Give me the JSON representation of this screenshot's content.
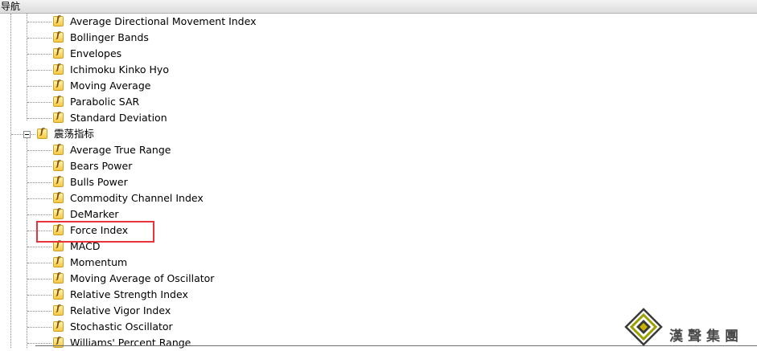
{
  "panel": {
    "title": "导航"
  },
  "tree": {
    "trend_items": [
      "Average Directional Movement Index",
      "Bollinger Bands",
      "Envelopes",
      "Ichimoku Kinko Hyo",
      "Moving Average",
      "Parabolic SAR",
      "Standard Deviation"
    ],
    "oscillators_folder": "震荡指标",
    "oscillator_items": [
      "Average True Range",
      "Bears Power",
      "Bulls Power",
      "Commodity Channel Index",
      "DeMarker",
      "Force Index",
      "MACD",
      "Momentum",
      "Moving Average of Oscillator",
      "Relative Strength Index",
      "Relative Vigor Index",
      "Stochastic Oscillator",
      "Williams' Percent Range"
    ],
    "highlighted_item": "Force Index"
  },
  "watermark": {
    "text": "漢聲集團"
  },
  "colors": {
    "highlight": "#e8343a",
    "icon_fill": "#f5c843"
  }
}
